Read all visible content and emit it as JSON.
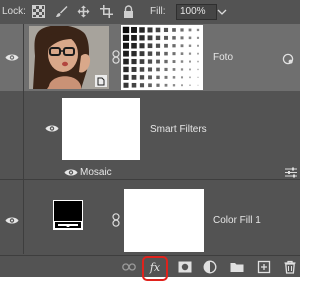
{
  "lock_bar": {
    "lock_label": "Lock:",
    "fill_label": "Fill:",
    "fill_value": "100%"
  },
  "layers": [
    {
      "name": "Foto",
      "type": "smart-object",
      "visible": true,
      "selected": true
    },
    {
      "name": "Smart Filters",
      "type": "smart-filters",
      "visible": true
    },
    {
      "name": "Mosaic",
      "type": "filter",
      "visible": true
    },
    {
      "name": "Color Fill 1",
      "type": "fill-layer",
      "visible": true
    }
  ],
  "toolbar": {
    "fx_label": "fx",
    "icons": [
      "link-layers-icon",
      "fx-icon",
      "add-mask-icon",
      "adjustment-layer-icon",
      "new-group-icon",
      "new-layer-icon",
      "delete-layer-icon"
    ]
  },
  "colors": {
    "panel_bg": "#535353",
    "selected_layer_bg": "#6f6f6f",
    "highlight": "#e0221c"
  }
}
